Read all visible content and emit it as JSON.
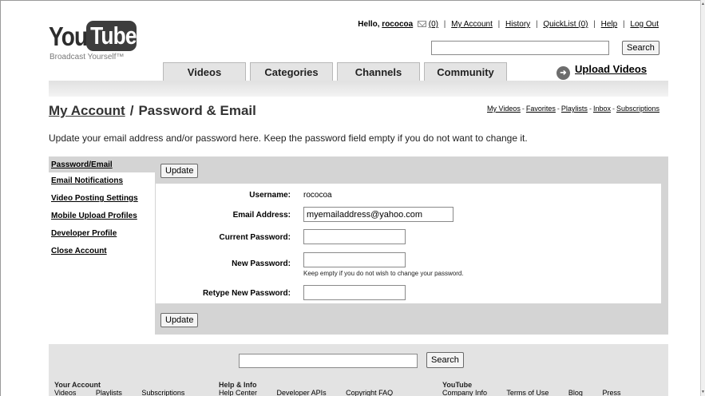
{
  "logo": {
    "you": "You",
    "tube": "Tube",
    "tagline": "Broadcast Yourself™"
  },
  "usernav": {
    "hello": "Hello,",
    "username": "rococoa",
    "inbox_count": "(0)",
    "my_account": "My Account",
    "history": "History",
    "quicklist": "QuickList",
    "quicklist_count": "(0)",
    "help": "Help",
    "logout": "Log Out"
  },
  "top_search": {
    "value": "",
    "button": "Search"
  },
  "tabs": [
    {
      "label": "Videos"
    },
    {
      "label": "Categories"
    },
    {
      "label": "Channels"
    },
    {
      "label": "Community"
    }
  ],
  "upload": {
    "label": "Upload Videos"
  },
  "page": {
    "account": "My Account",
    "slash": "/",
    "title": "Password & Email",
    "intro": "Update your email address and/or password here. Keep the password field empty if you do not want to change it."
  },
  "quick_links": [
    "My Videos",
    "Favorites",
    "Playlists",
    "Inbox",
    "Subscriptions"
  ],
  "sidebar": {
    "items": [
      {
        "label": "Password/Email",
        "active": true
      },
      {
        "label": "Email Notifications"
      },
      {
        "label": "Video Posting Settings"
      },
      {
        "label": "Mobile Upload Profiles"
      },
      {
        "label": "Developer Profile"
      },
      {
        "label": "Close Account"
      }
    ]
  },
  "form": {
    "update_button": "Update",
    "username_label": "Username:",
    "username_value": "rococoa",
    "email_label": "Email Address:",
    "email_value": "myemailaddress@yahoo.com",
    "current_password_label": "Current Password:",
    "new_password_label": "New Password:",
    "new_password_hint": "Keep empty if you do not wish to change your password.",
    "retype_label": "Retype New Password:"
  },
  "footer": {
    "search_value": "",
    "search_button": "Search",
    "columns": [
      {
        "heading": "Your Account",
        "links": [
          "Videos",
          "Playlists",
          "Subscriptions"
        ]
      },
      {
        "heading": "Help & Info",
        "links": [
          "Help Center",
          "Developer APIs",
          "Copyright FAQ"
        ]
      },
      {
        "heading": "YouTube",
        "links": [
          "Company Info",
          "Terms of Use",
          "Blog",
          "Press"
        ]
      }
    ]
  }
}
